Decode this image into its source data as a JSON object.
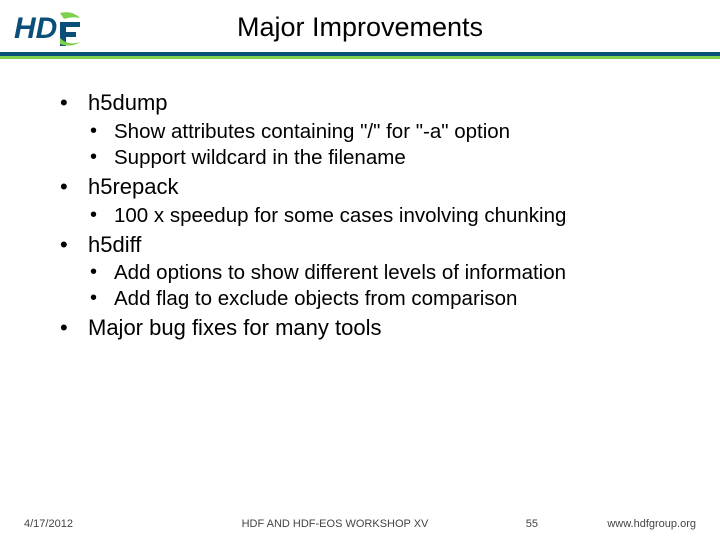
{
  "header": {
    "title": "Major Improvements"
  },
  "bullets": {
    "h5dump": {
      "label": "h5dump",
      "sub1": "Show attributes containing \"/\"  for \"-a\" option",
      "sub2": "Support wildcard in the filename"
    },
    "h5repack": {
      "label": "h5repack",
      "sub1": "100 x speedup for some cases involving chunking"
    },
    "h5diff": {
      "label": "h5diff",
      "sub1": "Add options to show different levels of information",
      "sub2": "Add flag to exclude objects from comparison"
    },
    "major": {
      "label": "Major bug fixes for many tools"
    }
  },
  "footer": {
    "date": "4/17/2012",
    "center": "HDF AND HDF-EOS WORKSHOP XV",
    "page": "55",
    "url": "www.hdfgroup.org"
  }
}
